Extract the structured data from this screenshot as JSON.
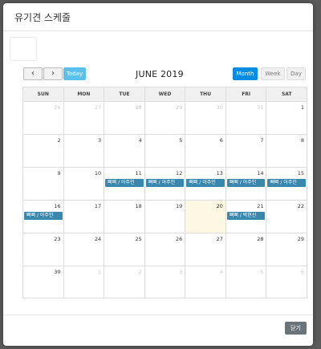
{
  "modal": {
    "title": "유기견 스케줄",
    "close_label": "닫기"
  },
  "toolbar": {
    "prev": "‹",
    "next": "›",
    "today": "Today",
    "title": "JUNE 2019",
    "views": {
      "month": "Month",
      "week": "Week",
      "day": "Day"
    }
  },
  "calendar": {
    "weekdays": [
      "SUN",
      "MON",
      "TUE",
      "WED",
      "THU",
      "FRI",
      "SAT"
    ],
    "weeks": [
      [
        {
          "n": "26",
          "o": true
        },
        {
          "n": "27",
          "o": true
        },
        {
          "n": "28",
          "o": true
        },
        {
          "n": "29",
          "o": true
        },
        {
          "n": "30",
          "o": true
        },
        {
          "n": "31",
          "o": true
        },
        {
          "n": "1"
        }
      ],
      [
        {
          "n": "2"
        },
        {
          "n": "3"
        },
        {
          "n": "4"
        },
        {
          "n": "5"
        },
        {
          "n": "6"
        },
        {
          "n": "7"
        },
        {
          "n": "8"
        }
      ],
      [
        {
          "n": "9"
        },
        {
          "n": "10"
        },
        {
          "n": "11",
          "e": "뻐삐 / 아주인"
        },
        {
          "n": "12",
          "e": "뻐삐 / 아주인"
        },
        {
          "n": "13",
          "e": "뻐삐 / 아주인"
        },
        {
          "n": "14",
          "e": "뻐삐 / 아주인"
        },
        {
          "n": "15",
          "e": "뻐삐 / 아주인"
        }
      ],
      [
        {
          "n": "16",
          "e": "뻐삐 / 아주인"
        },
        {
          "n": "17"
        },
        {
          "n": "18"
        },
        {
          "n": "19"
        },
        {
          "n": "20",
          "today": true
        },
        {
          "n": "21",
          "e": "뻐삐 / 박현선"
        },
        {
          "n": "22"
        }
      ],
      [
        {
          "n": "23"
        },
        {
          "n": "24"
        },
        {
          "n": "25"
        },
        {
          "n": "26"
        },
        {
          "n": "27"
        },
        {
          "n": "28"
        },
        {
          "n": "29"
        }
      ],
      [
        {
          "n": "30"
        },
        {
          "n": "1",
          "o": true
        },
        {
          "n": "2",
          "o": true
        },
        {
          "n": "3",
          "o": true
        },
        {
          "n": "4",
          "o": true
        },
        {
          "n": "5",
          "o": true
        },
        {
          "n": "6",
          "o": true
        }
      ]
    ]
  }
}
